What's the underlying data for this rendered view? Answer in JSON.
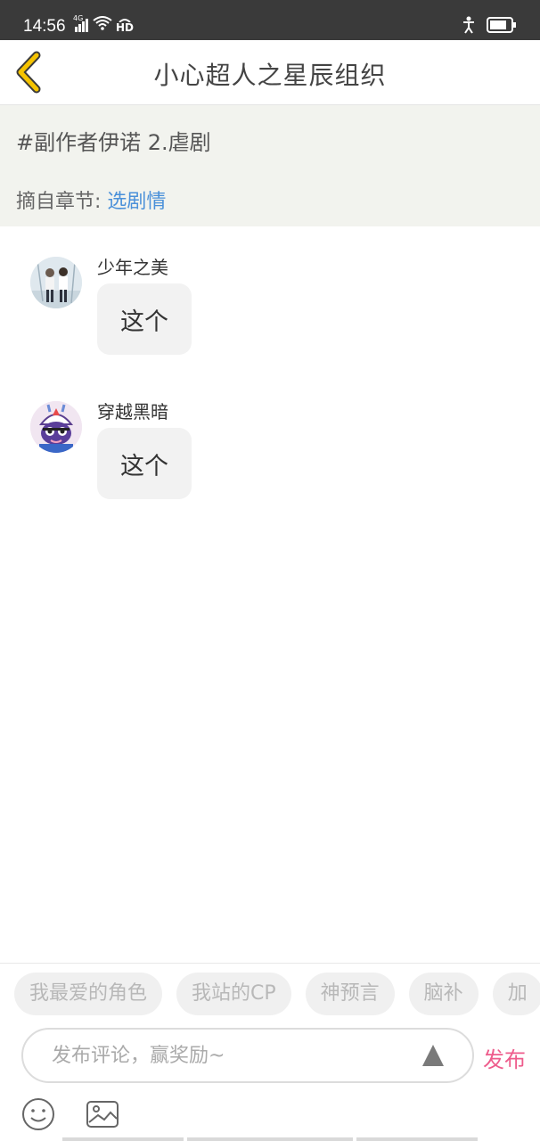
{
  "status_bar": {
    "time": "14:56",
    "network": "4G",
    "hd": "HD"
  },
  "header": {
    "title": "小心超人之星辰组织",
    "back_icon": "chevron-left-icon",
    "accent_color": "#f5c300"
  },
  "topic": {
    "title": "#副作者伊诺 2.虐剧",
    "chapter_label": "摘自章节:",
    "chapter_link": "选剧情",
    "link_color": "#4a90d9"
  },
  "messages": [
    {
      "username": "少年之美",
      "text": "这个",
      "avatar": "avatar-photo-icon"
    },
    {
      "username": "穿越黑暗",
      "text": "这个",
      "avatar": "avatar-cartoon-icon"
    }
  ],
  "bottom_bar": {
    "tags": [
      "我最爱的角色",
      "我站的CP",
      "神预言",
      "脑补",
      "加"
    ],
    "input_placeholder": "发布评论，赢奖励~",
    "publish_label": "发布",
    "publish_color": "#ee5c8c"
  }
}
